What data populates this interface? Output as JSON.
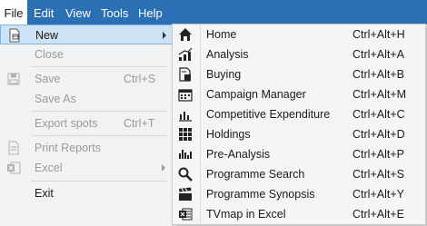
{
  "menubar": {
    "items": [
      "File",
      "Edit",
      "View",
      "Tools",
      "Help"
    ]
  },
  "file_menu": {
    "new": {
      "label": "New"
    },
    "close": {
      "label": "Close"
    },
    "save": {
      "label": "Save",
      "shortcut": "Ctrl+S"
    },
    "save_as": {
      "label": "Save As"
    },
    "export_spots": {
      "label": "Export spots",
      "shortcut": "Ctrl+T"
    },
    "print_reports": {
      "label": "Print Reports"
    },
    "excel": {
      "label": "Excel"
    },
    "exit": {
      "label": "Exit"
    }
  },
  "new_submenu": {
    "items": [
      {
        "label": "Home",
        "shortcut": "Ctrl+Alt+H",
        "icon": "home-icon"
      },
      {
        "label": "Analysis",
        "shortcut": "Ctrl+Alt+A",
        "icon": "analysis-chart-icon"
      },
      {
        "label": "Buying",
        "shortcut": "Ctrl+Alt+B",
        "icon": "buying-document-icon"
      },
      {
        "label": "Campaign Manager",
        "shortcut": "Ctrl+Alt+M",
        "icon": "calendar-icon"
      },
      {
        "label": "Competitive Expenditure",
        "shortcut": "Ctrl+Alt+C",
        "icon": "bar-chart-icon"
      },
      {
        "label": "Holdings",
        "shortcut": "Ctrl+Alt+D",
        "icon": "grid-icon"
      },
      {
        "label": "Pre-Analysis",
        "shortcut": "Ctrl+Alt+P",
        "icon": "pre-analysis-icon"
      },
      {
        "label": "Programme Search",
        "shortcut": "Ctrl+Alt+S",
        "icon": "search-icon"
      },
      {
        "label": "Programme Synopsis",
        "shortcut": "Ctrl+Alt+Y",
        "icon": "clapperboard-icon"
      },
      {
        "label": "TVmap in Excel",
        "shortcut": "Ctrl+Alt+E",
        "icon": "excel-icon"
      }
    ]
  },
  "colors": {
    "menubar": "#2b6fb5",
    "selected": "#cde3f5",
    "disabled_text": "#9a9a9a"
  }
}
